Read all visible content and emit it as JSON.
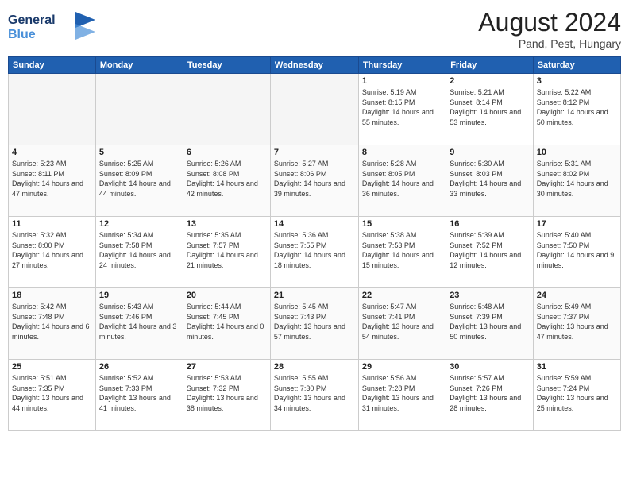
{
  "header": {
    "logo_line1": "General",
    "logo_line2": "Blue",
    "month_year": "August 2024",
    "location": "Pand, Pest, Hungary"
  },
  "weekdays": [
    "Sunday",
    "Monday",
    "Tuesday",
    "Wednesday",
    "Thursday",
    "Friday",
    "Saturday"
  ],
  "weeks": [
    [
      {
        "day": "",
        "empty": true
      },
      {
        "day": "",
        "empty": true
      },
      {
        "day": "",
        "empty": true
      },
      {
        "day": "",
        "empty": true
      },
      {
        "day": "1",
        "sunrise": "5:19 AM",
        "sunset": "8:15 PM",
        "daylight": "14 hours and 55 minutes."
      },
      {
        "day": "2",
        "sunrise": "5:21 AM",
        "sunset": "8:14 PM",
        "daylight": "14 hours and 53 minutes."
      },
      {
        "day": "3",
        "sunrise": "5:22 AM",
        "sunset": "8:12 PM",
        "daylight": "14 hours and 50 minutes."
      }
    ],
    [
      {
        "day": "4",
        "sunrise": "5:23 AM",
        "sunset": "8:11 PM",
        "daylight": "14 hours and 47 minutes."
      },
      {
        "day": "5",
        "sunrise": "5:25 AM",
        "sunset": "8:09 PM",
        "daylight": "14 hours and 44 minutes."
      },
      {
        "day": "6",
        "sunrise": "5:26 AM",
        "sunset": "8:08 PM",
        "daylight": "14 hours and 42 minutes."
      },
      {
        "day": "7",
        "sunrise": "5:27 AM",
        "sunset": "8:06 PM",
        "daylight": "14 hours and 39 minutes."
      },
      {
        "day": "8",
        "sunrise": "5:28 AM",
        "sunset": "8:05 PM",
        "daylight": "14 hours and 36 minutes."
      },
      {
        "day": "9",
        "sunrise": "5:30 AM",
        "sunset": "8:03 PM",
        "daylight": "14 hours and 33 minutes."
      },
      {
        "day": "10",
        "sunrise": "5:31 AM",
        "sunset": "8:02 PM",
        "daylight": "14 hours and 30 minutes."
      }
    ],
    [
      {
        "day": "11",
        "sunrise": "5:32 AM",
        "sunset": "8:00 PM",
        "daylight": "14 hours and 27 minutes."
      },
      {
        "day": "12",
        "sunrise": "5:34 AM",
        "sunset": "7:58 PM",
        "daylight": "14 hours and 24 minutes."
      },
      {
        "day": "13",
        "sunrise": "5:35 AM",
        "sunset": "7:57 PM",
        "daylight": "14 hours and 21 minutes."
      },
      {
        "day": "14",
        "sunrise": "5:36 AM",
        "sunset": "7:55 PM",
        "daylight": "14 hours and 18 minutes."
      },
      {
        "day": "15",
        "sunrise": "5:38 AM",
        "sunset": "7:53 PM",
        "daylight": "14 hours and 15 minutes."
      },
      {
        "day": "16",
        "sunrise": "5:39 AM",
        "sunset": "7:52 PM",
        "daylight": "14 hours and 12 minutes."
      },
      {
        "day": "17",
        "sunrise": "5:40 AM",
        "sunset": "7:50 PM",
        "daylight": "14 hours and 9 minutes."
      }
    ],
    [
      {
        "day": "18",
        "sunrise": "5:42 AM",
        "sunset": "7:48 PM",
        "daylight": "14 hours and 6 minutes."
      },
      {
        "day": "19",
        "sunrise": "5:43 AM",
        "sunset": "7:46 PM",
        "daylight": "14 hours and 3 minutes."
      },
      {
        "day": "20",
        "sunrise": "5:44 AM",
        "sunset": "7:45 PM",
        "daylight": "14 hours and 0 minutes."
      },
      {
        "day": "21",
        "sunrise": "5:45 AM",
        "sunset": "7:43 PM",
        "daylight": "13 hours and 57 minutes."
      },
      {
        "day": "22",
        "sunrise": "5:47 AM",
        "sunset": "7:41 PM",
        "daylight": "13 hours and 54 minutes."
      },
      {
        "day": "23",
        "sunrise": "5:48 AM",
        "sunset": "7:39 PM",
        "daylight": "13 hours and 50 minutes."
      },
      {
        "day": "24",
        "sunrise": "5:49 AM",
        "sunset": "7:37 PM",
        "daylight": "13 hours and 47 minutes."
      }
    ],
    [
      {
        "day": "25",
        "sunrise": "5:51 AM",
        "sunset": "7:35 PM",
        "daylight": "13 hours and 44 minutes."
      },
      {
        "day": "26",
        "sunrise": "5:52 AM",
        "sunset": "7:33 PM",
        "daylight": "13 hours and 41 minutes."
      },
      {
        "day": "27",
        "sunrise": "5:53 AM",
        "sunset": "7:32 PM",
        "daylight": "13 hours and 38 minutes."
      },
      {
        "day": "28",
        "sunrise": "5:55 AM",
        "sunset": "7:30 PM",
        "daylight": "13 hours and 34 minutes."
      },
      {
        "day": "29",
        "sunrise": "5:56 AM",
        "sunset": "7:28 PM",
        "daylight": "13 hours and 31 minutes."
      },
      {
        "day": "30",
        "sunrise": "5:57 AM",
        "sunset": "7:26 PM",
        "daylight": "13 hours and 28 minutes."
      },
      {
        "day": "31",
        "sunrise": "5:59 AM",
        "sunset": "7:24 PM",
        "daylight": "13 hours and 25 minutes."
      }
    ]
  ]
}
